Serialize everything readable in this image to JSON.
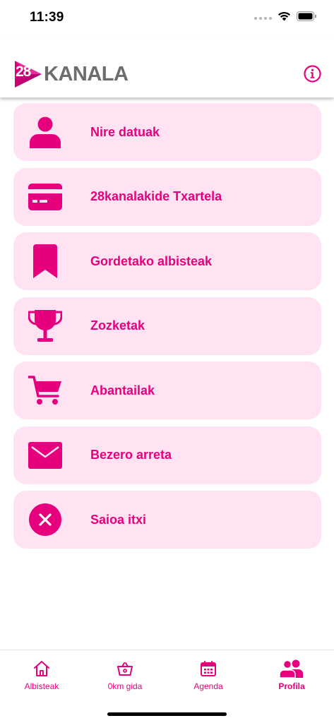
{
  "status_bar": {
    "time": "11:39"
  },
  "header": {
    "logo_number": "28",
    "logo_text": "KANALA"
  },
  "menu": {
    "items": [
      {
        "label": "Nire datuak",
        "icon": "user-icon"
      },
      {
        "label": "28kanalakide Txartela",
        "icon": "credit-card-icon"
      },
      {
        "label": "Gordetako albisteak",
        "icon": "bookmark-icon"
      },
      {
        "label": "Zozketak",
        "icon": "trophy-icon"
      },
      {
        "label": "Abantailak",
        "icon": "shopping-cart-icon"
      },
      {
        "label": "Bezero arreta",
        "icon": "envelope-icon"
      },
      {
        "label": "Saioa itxi",
        "icon": "close-circle-icon"
      }
    ]
  },
  "tab_bar": {
    "tabs": [
      {
        "label": "Albisteak",
        "icon": "home-icon"
      },
      {
        "label": "0km gida",
        "icon": "basket-icon"
      },
      {
        "label": "Agenda",
        "icon": "calendar-icon"
      },
      {
        "label": "Profila",
        "icon": "users-icon",
        "active": true
      }
    ]
  },
  "colors": {
    "accent": "#e6007e",
    "item_background": "#ffe3f3",
    "logo_text": "#6d6d6d"
  }
}
